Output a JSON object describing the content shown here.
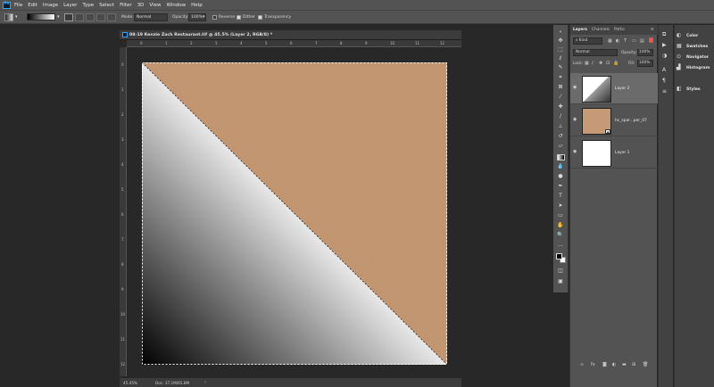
{
  "menu": [
    "File",
    "Edit",
    "Image",
    "Layer",
    "Type",
    "Select",
    "Filter",
    "3D",
    "View",
    "Window",
    "Help"
  ],
  "app_badge": "Ps",
  "options": {
    "mode_label": "Mode:",
    "mode_value": "Normal",
    "opacity_label": "Opacity:",
    "opacity_value": "100%",
    "reverse_label": "Reverse",
    "reverse_checked": false,
    "dither_label": "Dither",
    "dither_checked": true,
    "transparency_label": "Transparency",
    "transparency_checked": true
  },
  "document": {
    "title": "08-19 Kenzie Zach Restaurant.tif @ 45.5% (Layer 2, RGB/8) *",
    "zoom": "45.45%",
    "doc_info": "Doc: 37.1M/65.8M",
    "ruler_top": [
      "0",
      "1",
      "2",
      "3",
      "4",
      "5",
      "6",
      "7",
      "8",
      "9",
      "10",
      "11",
      "12"
    ],
    "ruler_left": [
      "0",
      "1",
      "2",
      "3",
      "4",
      "5",
      "6",
      "7",
      "8",
      "9",
      "10",
      "11",
      "12"
    ]
  },
  "layers_panel": {
    "tabs": [
      "Layers",
      "Channels",
      "Paths"
    ],
    "kind_label": "Kind",
    "blend_mode": "Normal",
    "opacity_label": "Opacity:",
    "opacity_value": "100%",
    "lock_label": "Lock:",
    "fill_label": "Fill:",
    "fill_value": "100%",
    "layers": [
      {
        "name": "Layer 2",
        "selected": true
      },
      {
        "name": "hc_spar...per_07",
        "selected": false
      },
      {
        "name": "Layer 1",
        "selected": false
      }
    ]
  },
  "right_panels": [
    "Color",
    "Swatches",
    "Navigator",
    "Histogram",
    "Styles"
  ],
  "colors": {
    "kraft": "#c69a74",
    "panel": "#535353",
    "background": "#282828"
  }
}
